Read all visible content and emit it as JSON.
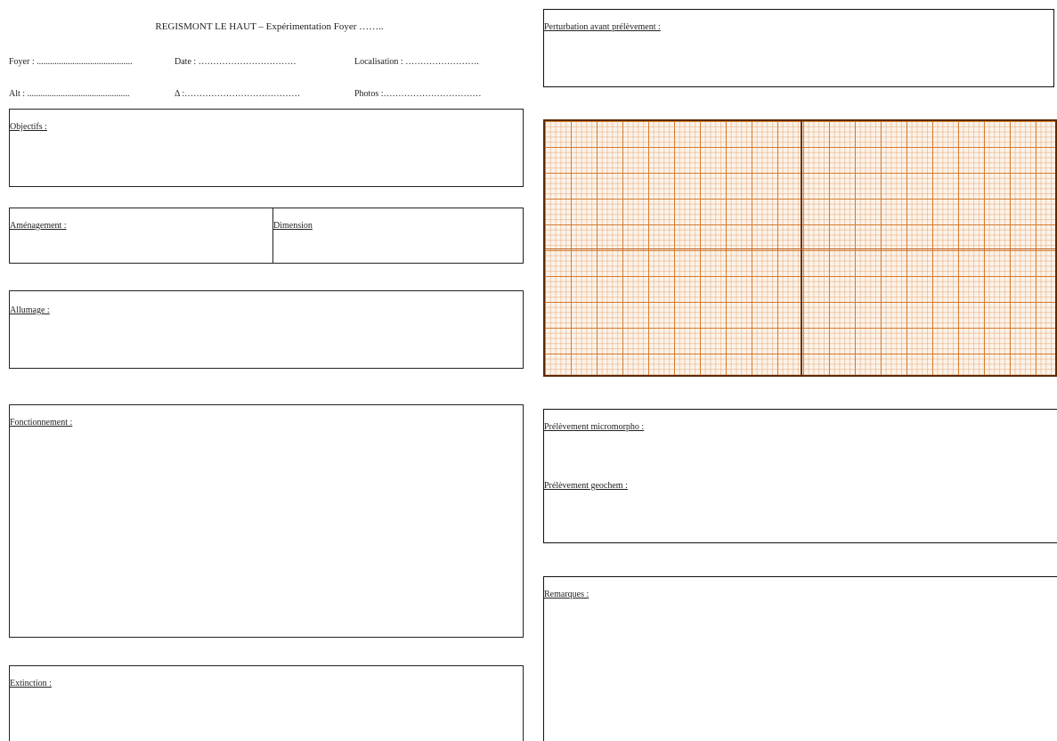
{
  "header": {
    "title": "REGISMONT LE HAUT – Expérimentation Foyer ……..",
    "fields_row1": {
      "foyer": "Foyer : ...........................................",
      "date": "Date : ……………………………",
      "localisation": "Localisation : ……………………."
    },
    "fields_row2": {
      "alt": "Alt : ..............................................",
      "delta": "Δ :…………………………………",
      "photos": "Photos :……………………………"
    }
  },
  "left": {
    "objectifs": "Objectifs :",
    "amenagement": "Aménagement :",
    "dimension": "Dimension",
    "allumage": "Allumage :",
    "fonctionnement": "Fonctionnement :",
    "extinction": "Extinction :"
  },
  "right": {
    "perturbation": "Perturbation avant prélèvement :",
    "prelevement_micromorpho": "Prélèvement micromorpho :",
    "prelevement_geochem": "Prélèvement geochem :",
    "remarques": "Remarques :"
  },
  "colors": {
    "grid_major": "#d67828",
    "grid_minor": "#e0965a",
    "grid_border": "#5a2a06",
    "grid_paper": "#fbf3ea"
  }
}
